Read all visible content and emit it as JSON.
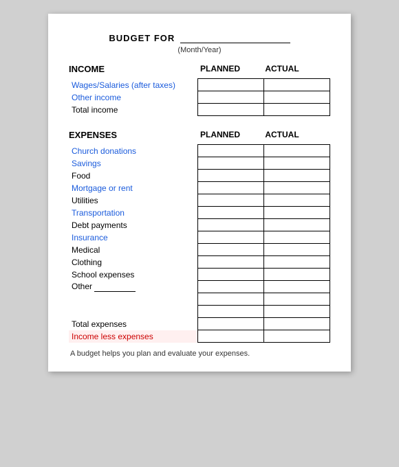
{
  "header": {
    "budget_for_label": "BUDGET FOR",
    "month_year_label": "(Month/Year)"
  },
  "income_section": {
    "title": "INCOME",
    "planned_label": "PLANNED",
    "actual_label": "ACTUAL",
    "rows": [
      {
        "label": "Wages/Salaries (after taxes)",
        "label_class": "label-blue"
      },
      {
        "label": "Other income",
        "label_class": "label-blue"
      },
      {
        "label": "Total income",
        "label_class": "label-black"
      }
    ]
  },
  "expenses_section": {
    "title": "EXPENSES",
    "planned_label": "PLANNED",
    "actual_label": "ACTUAL",
    "rows": [
      {
        "label": "Church donations",
        "label_class": "label-blue"
      },
      {
        "label": "Savings",
        "label_class": "label-blue"
      },
      {
        "label": "Food",
        "label_class": "label-black"
      },
      {
        "label": "Mortgage or rent",
        "label_class": "label-blue"
      },
      {
        "label": "Utilities",
        "label_class": "label-black"
      },
      {
        "label": "Transportation",
        "label_class": "label-blue"
      },
      {
        "label": "Debt payments",
        "label_class": "label-black"
      },
      {
        "label": "Insurance",
        "label_class": "label-blue"
      },
      {
        "label": "Medical",
        "label_class": "label-black"
      },
      {
        "label": "Clothing",
        "label_class": "label-black"
      },
      {
        "label": "School expenses",
        "label_class": "label-black"
      },
      {
        "label": "Other",
        "label_class": "label-black"
      }
    ],
    "extra_rows": 2,
    "total_row": {
      "label": "Total expenses",
      "label_class": "label-black"
    },
    "income_less_row": {
      "label": "Income less expenses",
      "label_class": "label-red"
    }
  },
  "footer": {
    "note": "A budget helps you plan and evaluate your expenses."
  }
}
